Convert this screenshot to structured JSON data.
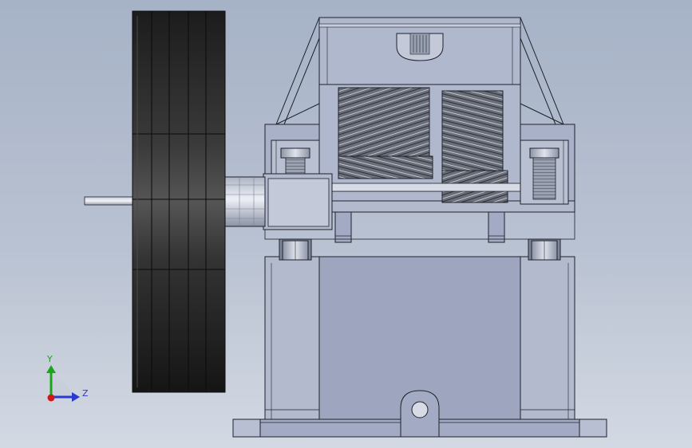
{
  "viewport": {
    "background_top": "#a6b2c6",
    "background_bottom": "#d3d9e3"
  },
  "model": {
    "edge_color": "#1e222a",
    "housing_fill": "#a3abc4",
    "housing_shade": "#8f98b3",
    "flywheel_fill": "#2a2a2a",
    "gear_fill": "#5a5e68"
  },
  "triad": {
    "y_label": "Y",
    "z_label": "Z",
    "y_color": "#1aa51a",
    "z_color": "#2a3ad0",
    "x_color": "#d01818"
  }
}
